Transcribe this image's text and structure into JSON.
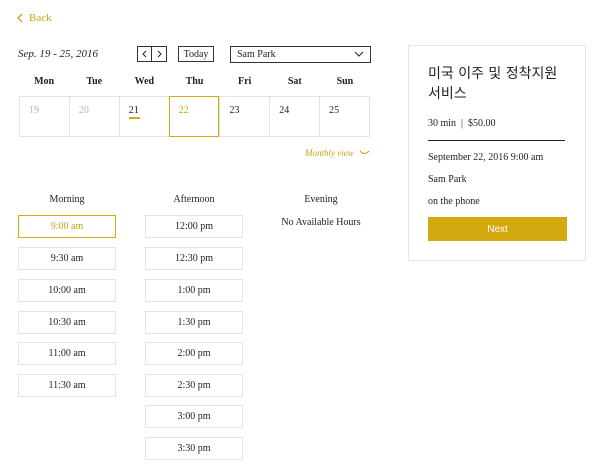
{
  "back": {
    "label": "Back"
  },
  "calendar": {
    "range_label": "Sep. 19 - 25, 2016",
    "prev_label": "‹",
    "next_label": "›",
    "today_label": "Today",
    "staff_selected": "Sam Park",
    "weekdays": [
      "Mon",
      "Tue",
      "Wed",
      "Thu",
      "Fri",
      "Sat",
      "Sun"
    ],
    "days": [
      "19",
      "20",
      "21",
      "22",
      "23",
      "24",
      "25"
    ],
    "monthly_view_label": "Monthly view"
  },
  "slots": {
    "morning_title": "Morning",
    "afternoon_title": "Afternoon",
    "evening_title": "Evening",
    "morning": [
      "9:00 am",
      "9:30 am",
      "10:00 am",
      "10:30 am",
      "11:00 am",
      "11:30 am"
    ],
    "afternoon": [
      "12:00 pm",
      "12:30 pm",
      "1:00 pm",
      "1:30 pm",
      "2:00 pm",
      "2:30 pm",
      "3:00 pm",
      "3:30 pm"
    ],
    "evening_empty": "No Available Hours"
  },
  "summary": {
    "service_name": "미국 이주 및 정착지원 서비스",
    "duration_price": "30 min  |  $50.00",
    "datetime": "September 22, 2016 9:00 am",
    "staff": "Sam Park",
    "location": "on the phone",
    "next_label": "Next"
  },
  "colors": {
    "accent": "#d4a90f",
    "border": "#e3e3e3"
  }
}
